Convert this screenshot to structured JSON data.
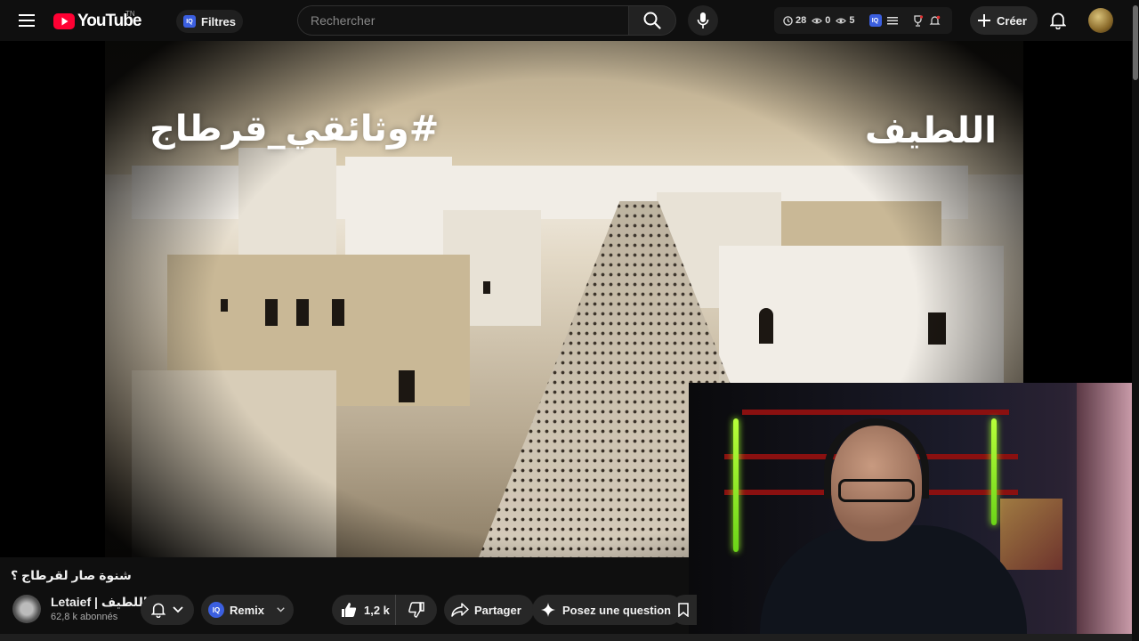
{
  "header": {
    "logo_text": "YouTube",
    "logo_tm": "TN",
    "filters_label": "Filtres",
    "iq_label": "IQ",
    "search": {
      "placeholder": "Rechercher",
      "value": ""
    },
    "stats": {
      "watch_count": "28",
      "view_count": "0",
      "eye_count": "5"
    },
    "create_label": "Créer"
  },
  "video": {
    "overlay_left": "#وثائقي_قرطاج",
    "overlay_right": "اللطيف"
  },
  "info": {
    "title": "شنوة صار لقرطاج ؟",
    "channel_name": "Letaief | اللطيف",
    "subscribers": "62,8 k abonnés",
    "remix_label": "Remix",
    "like_count": "1,2 k",
    "share_label": "Partager",
    "ask_label": "Posez une question"
  },
  "colors": {
    "background": "#0f0f0f",
    "youtube_red": "#ff0033",
    "iq_blue": "#3b5fe0",
    "pill": "#272727"
  }
}
